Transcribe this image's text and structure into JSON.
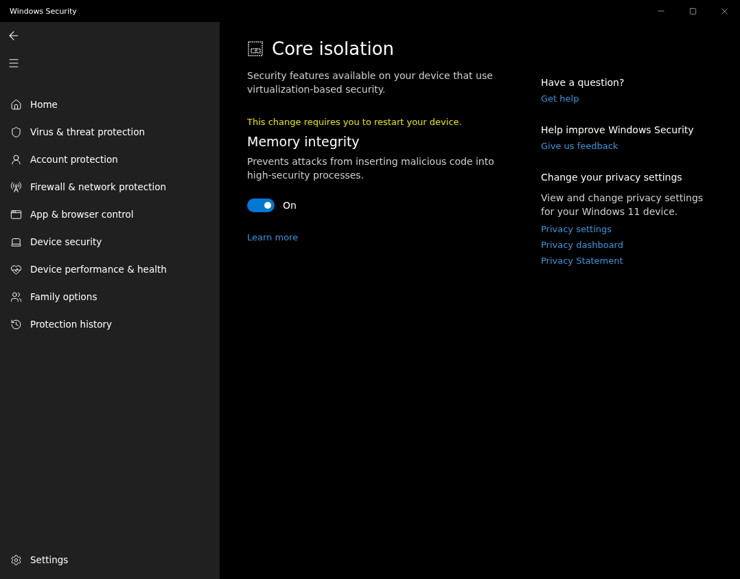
{
  "window": {
    "title": "Windows Security"
  },
  "sidebar": {
    "items": [
      {
        "label": "Home",
        "selected": false
      },
      {
        "label": "Virus & threat protection",
        "selected": false
      },
      {
        "label": "Account protection",
        "selected": false
      },
      {
        "label": "Firewall & network protection",
        "selected": false
      },
      {
        "label": "App & browser control",
        "selected": false
      },
      {
        "label": "Device security",
        "selected": false
      },
      {
        "label": "Device performance & health",
        "selected": false
      },
      {
        "label": "Family options",
        "selected": false
      },
      {
        "label": "Protection history",
        "selected": false
      }
    ],
    "settings": {
      "label": "Settings"
    }
  },
  "main": {
    "title": "Core isolation",
    "description": "Security features available on your device that use virtualization-based security.",
    "warning": "This change requires you to restart your device.",
    "section": {
      "title": "Memory integrity",
      "description": "Prevents attacks from inserting malicious code into high-security processes.",
      "toggle": {
        "on": true,
        "label": "On"
      },
      "link": "Learn more"
    }
  },
  "aside": [
    {
      "title": "Have a question?",
      "links": [
        "Get help"
      ]
    },
    {
      "title": "Help improve Windows Security",
      "links": [
        "Give us feedback"
      ]
    },
    {
      "title": "Change your privacy settings",
      "text": "View and change privacy settings for your Windows 11 device.",
      "links": [
        "Privacy settings",
        "Privacy dashboard",
        "Privacy Statement"
      ]
    }
  ]
}
